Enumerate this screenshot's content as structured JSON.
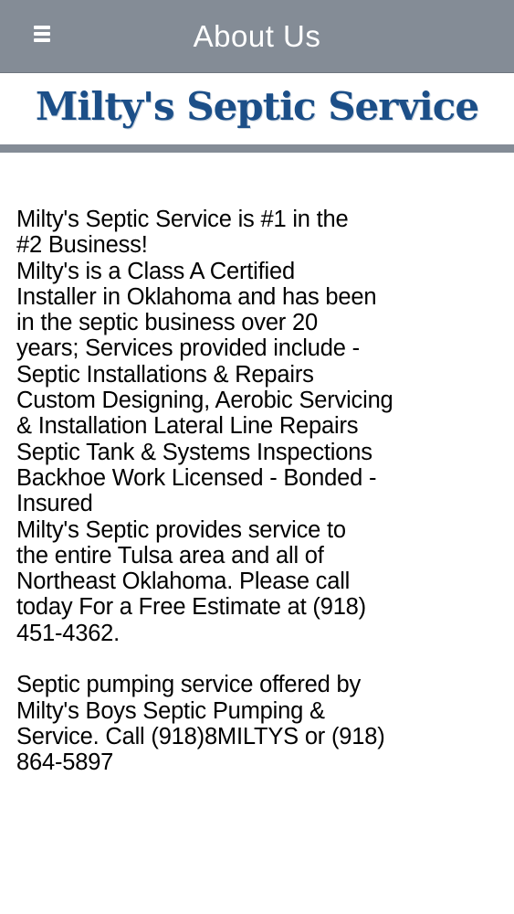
{
  "header": {
    "title": "About Us",
    "menu_icon": "hamburger-menu-icon"
  },
  "brand": {
    "name": "Milty's Septic Service",
    "color": "#1c4f88"
  },
  "theme": {
    "header_bg": "#848c96",
    "text_color": "#000000"
  },
  "content": {
    "paragraph1_lines": [
      "Milty's Septic Service is #1 in the",
      "#2 Business!",
      "Milty's is a Class A Certified",
      "Installer in Oklahoma and has been",
      "in the septic business over 20",
      "years; Services provided include -",
      "Septic Installations & Repairs",
      "Custom Designing, Aerobic Servicing",
      "& Installation Lateral Line Repairs",
      "Septic Tank & Systems Inspections",
      "Backhoe Work Licensed - Bonded -",
      "Insured",
      "Milty's Septic provides service to",
      "the entire Tulsa area and all of",
      "Northeast Oklahoma. Please call",
      "today For a Free Estimate at (918)",
      "451-4362."
    ],
    "paragraph2_lines": [
      "Septic pumping service offered by",
      "Milty's Boys Septic Pumping &",
      "Service. Call (918)8MILTYS or (918)",
      "864-5897"
    ]
  }
}
